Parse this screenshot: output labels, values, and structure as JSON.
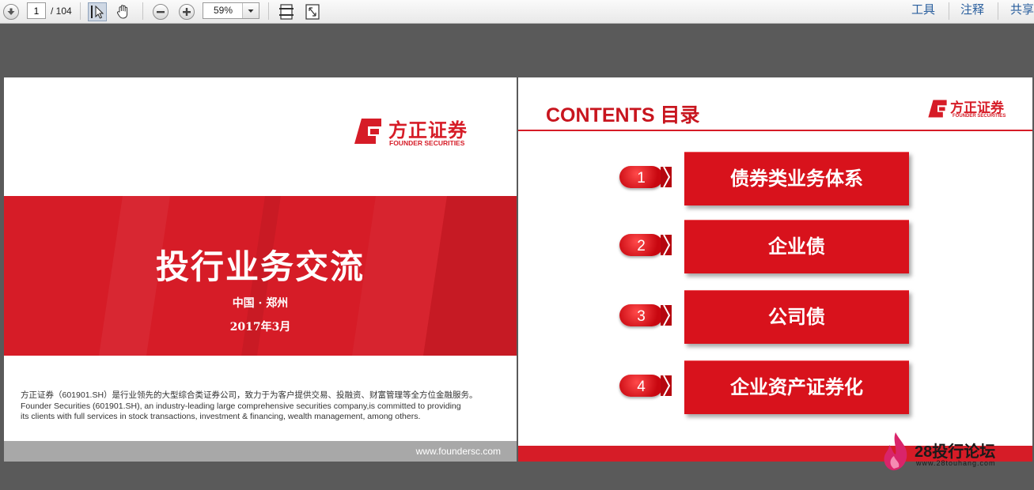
{
  "toolbar": {
    "page_current": "1",
    "page_total": "/ 104",
    "zoom": "59%",
    "menu": [
      "工具",
      "注释",
      "共享"
    ]
  },
  "slide1": {
    "logo_cn": "方正证券",
    "logo_en": "FOUNDER SECURITIES",
    "title": "投行业务交流",
    "location": "中国 · 郑州",
    "date": "2017年3月",
    "desc_cn": "方正证券（601901.SH）是行业领先的大型综合类证券公司，致力于为客户提供交易、投融资、财富管理等全方位金融服务。",
    "desc_en_1": "Founder Securities (601901.SH), an industry-leading large comprehensive securities company,is committed to providing",
    "desc_en_2": "its clients with full services in stock transactions, investment & financing, wealth management, among others.",
    "website": "www.foundersc.com"
  },
  "slide2": {
    "heading": "CONTENTS 目录",
    "logo_cn": "方正证券",
    "logo_en": "FOUNDER SECURITIES",
    "items": [
      {
        "num": "1",
        "label": "债券类业务体系"
      },
      {
        "num": "2",
        "label": "企业债"
      },
      {
        "num": "3",
        "label": "公司债"
      },
      {
        "num": "4",
        "label": "企业资产证券化"
      }
    ]
  },
  "watermark": {
    "brand": "28投行论坛",
    "url": "www.28touhang.com"
  },
  "colors": {
    "brand_red": "#d61c27",
    "toolbar_link": "#2a5f9e"
  }
}
